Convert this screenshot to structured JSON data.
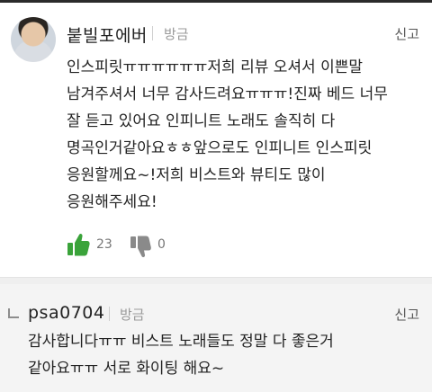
{
  "comment": {
    "username": "붙빌포에버",
    "time": "방금",
    "report_label": "신고",
    "text": "인스피릿ㅠㅠㅠㅠㅠㅠ저희 리뷰 오셔서 이쁜말\n남겨주셔서 너무 감사드려요ㅠㅠㅠ!진짜 베드 너무\n잘 듣고 있어요 인피니트 노래도 솔직히 다\n명곡인거같아요ㅎㅎ앞으로도 인피니트 인스피릿\n응원할께요~!저희 비스트와 뷰티도 많이\n응원해주세요!",
    "like_count": "23",
    "dislike_count": "0",
    "like_color": "#3aa33a",
    "dislike_color": "#8a8a8a"
  },
  "reply": {
    "username": "psa0704",
    "time": "방금",
    "report_label": "신고",
    "text": "감사합니다ㅠㅠ 비스트 노래들도 정말 다 좋은거\n같아요ㅠㅠ 서로 화이팅 해요~"
  }
}
